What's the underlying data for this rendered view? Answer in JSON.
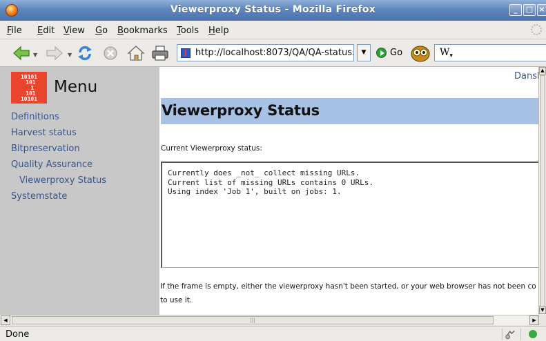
{
  "window": {
    "title": "Viewerproxy Status - Mozilla Firefox"
  },
  "menubar": {
    "items": [
      {
        "pre": "",
        "u": "F",
        "post": "ile"
      },
      {
        "pre": "",
        "u": "E",
        "post": "dit"
      },
      {
        "pre": "",
        "u": "V",
        "post": "iew"
      },
      {
        "pre": "",
        "u": "G",
        "post": "o"
      },
      {
        "pre": "",
        "u": "B",
        "post": "ookmarks"
      },
      {
        "pre": "",
        "u": "T",
        "post": "ools"
      },
      {
        "pre": "",
        "u": "H",
        "post": "elp"
      }
    ]
  },
  "navbar": {
    "url": "http://localhost:8073/QA/QA-status.",
    "go_label": "Go",
    "search_value": "W"
  },
  "icons": {
    "back": "arrow-left-icon",
    "forward": "arrow-right-icon",
    "reload": "reload-icon",
    "stop": "stop-icon",
    "home": "home-icon",
    "print": "printer-icon",
    "go": "go-icon",
    "search_engine": "owl-icon"
  },
  "colors": {
    "titlebar": "#5f86bd",
    "sidebar": "#c8c8c8",
    "heading_bg": "#a7c2e4",
    "link": "#35538c",
    "logo": "#e8452c"
  },
  "sidebar": {
    "logo_text": "10101\n 101\n  1\n 101\n10101",
    "heading": "Menu",
    "links": [
      {
        "label": "Definitions",
        "sub": false
      },
      {
        "label": "Harvest status",
        "sub": false
      },
      {
        "label": "Bitpreservation",
        "sub": false
      },
      {
        "label": "Quality Assurance",
        "sub": false
      },
      {
        "label": "Viewerproxy Status",
        "sub": true
      },
      {
        "label": "Systemstate",
        "sub": false
      }
    ]
  },
  "page": {
    "language_link": "Dansk",
    "heading": "Viewerproxy Status",
    "status_label": "Current Viewerproxy status:",
    "status_lines": [
      "Currently does _not_ collect missing URLs.",
      "Current list of missing URLs contains 0 URLs.",
      "Using index 'Job 1', built on jobs: 1."
    ],
    "footnote_line1": "If the frame is empty, either the viewerproxy hasn't been started, or your web browser has not been co",
    "footnote_line2": "to use it."
  },
  "statusbar": {
    "text": "Done"
  }
}
